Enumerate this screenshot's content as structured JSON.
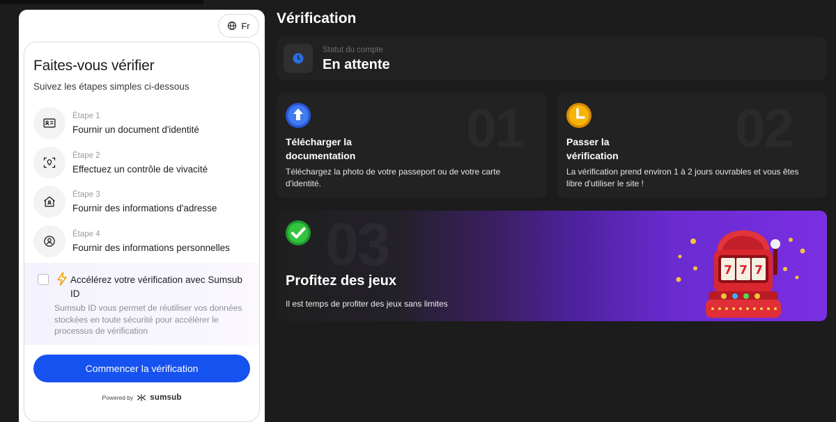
{
  "widget": {
    "language": "Fr",
    "title": "Faites-vous vérifier",
    "subtitle": "Suivez les étapes simples ci-dessous",
    "steps": [
      {
        "number": "Étape 1",
        "label": "Fournir un document d'identité",
        "icon": "id-card-icon"
      },
      {
        "number": "Étape 2",
        "label": "Effectuez un contrôle de vivacité",
        "icon": "face-scan-icon"
      },
      {
        "number": "Étape 3",
        "label": "Fournir des informations d'adresse",
        "icon": "home-address-icon"
      },
      {
        "number": "Étape 4",
        "label": "Fournir des informations personnelles",
        "icon": "user-circle-icon"
      }
    ],
    "speedup": {
      "title": "Accélérez votre vérification avec Sumsub ID",
      "description": "Sumsub ID vous permet de réutiliser vos données stockées en toute sécurité pour accélérer le processus de vérification",
      "checked": false
    },
    "start_button": "Commencer la vérification",
    "powered_by": "Powered by",
    "brand": "sumsub"
  },
  "page": {
    "title": "Vérification",
    "status": {
      "label": "Statut du compte",
      "value": "En attente"
    },
    "cards": [
      {
        "number": "01",
        "title_line1": "Télécharger la",
        "title_line2": "documentation",
        "desc_line1": "Téléchargez la photo de votre passeport ou de votre carte",
        "desc_line2": "d'identité.",
        "icon": "upload-arrow-icon"
      },
      {
        "number": "02",
        "title_line1": "Passer la",
        "title_line2": "vérification",
        "desc_line1": "La vérification prend environ 1 à 2 jours ouvrables et vous êtes",
        "desc_line2": "libre d'utiliser le site !",
        "icon": "clock-icon"
      }
    ],
    "promo": {
      "number": "03",
      "title": "Profitez des jeux",
      "description": "Il est temps de profiter des jeux sans limites",
      "slot_text": "777"
    }
  },
  "colors": {
    "accent": "#1652f0",
    "background": "#1c1c1c",
    "card": "#222222",
    "promo_purple": "#7a2fe3"
  }
}
